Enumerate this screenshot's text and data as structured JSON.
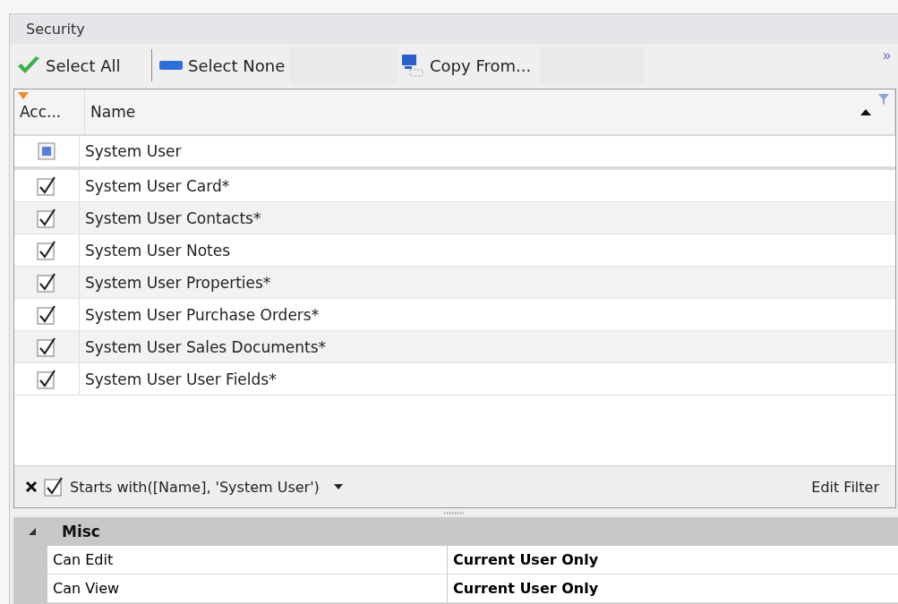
{
  "panel": {
    "title": "Security"
  },
  "toolbar": {
    "buttons": [
      {
        "kind": "check",
        "label": "Select All"
      },
      {
        "kind": "bar",
        "label": "Select None"
      },
      {
        "kind": "copy",
        "label": "Copy From..."
      }
    ],
    "overflow": "»"
  },
  "grid": {
    "columns": [
      {
        "label": "Acc..."
      },
      {
        "label": "Name"
      }
    ],
    "group_row": {
      "name": "System User",
      "partial": true
    },
    "rows": [
      {
        "name": "System User Card*",
        "checked": true
      },
      {
        "name": "System User Contacts*",
        "checked": true
      },
      {
        "name": "System User Notes",
        "checked": true
      },
      {
        "name": "System User Properties*",
        "checked": true
      },
      {
        "name": "System User Purchase Orders*",
        "checked": true
      },
      {
        "name": "System User Sales Documents*",
        "checked": true
      },
      {
        "name": "System User User Fields*",
        "checked": true
      }
    ],
    "filter": {
      "enabled": true,
      "text": "Starts with([Name], 'System User')",
      "edit": "Edit Filter"
    }
  },
  "properties": {
    "category": "Misc",
    "expanded": true,
    "rows": [
      {
        "name": "Can Edit",
        "value": "Current User Only"
      },
      {
        "name": "Can View",
        "value": "Current User Only"
      }
    ]
  }
}
